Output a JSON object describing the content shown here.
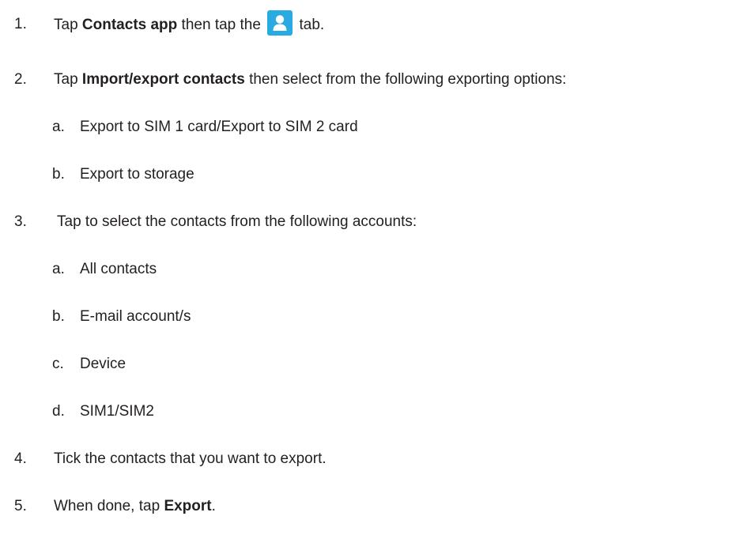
{
  "steps": [
    {
      "number": "1.",
      "before": "Tap ",
      "bold": "Contacts app",
      "middle": " then tap the ",
      "icon": "contacts-person-icon",
      "after": " tab."
    },
    {
      "number": "2.",
      "before": "Tap ",
      "bold": "Import/export contacts",
      "after": " then select from the following exporting options:",
      "subitems": [
        {
          "letter": "a.",
          "text": "Export to SIM 1 card/Export to SIM 2 card"
        },
        {
          "letter": "b.",
          "text": "Export to storage"
        }
      ]
    },
    {
      "number": "3.",
      "text": "Tap to select the contacts from the following accounts:",
      "subitems": [
        {
          "letter": "a.",
          "text": "All contacts"
        },
        {
          "letter": "b.",
          "text": "E-mail account/s"
        },
        {
          "letter": "c.",
          "text": "Device"
        },
        {
          "letter": "d.",
          "text": "SIM1/SIM2"
        }
      ]
    },
    {
      "number": "4.",
      "text": "Tick the contacts that you want to export."
    },
    {
      "number": "5.",
      "before": "When done, tap ",
      "bold": "Export",
      "after": "."
    }
  ],
  "colors": {
    "text": "#231f20",
    "icon_bg": "#29abe2",
    "icon_fg": "#ffffff"
  }
}
